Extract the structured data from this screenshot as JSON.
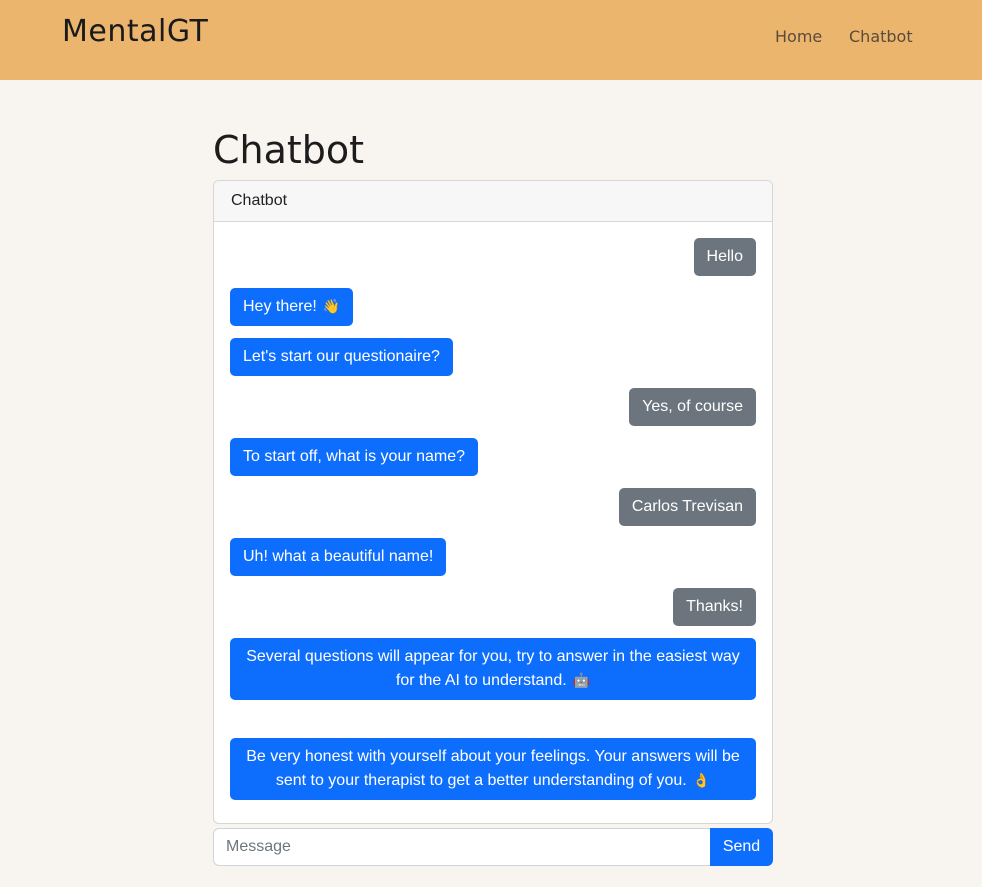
{
  "navbar": {
    "brand": "MentalGT",
    "links": [
      {
        "label": "Home"
      },
      {
        "label": "Chatbot"
      }
    ]
  },
  "page_title": "Chatbot",
  "card": {
    "header": "Chatbot",
    "messages": [
      {
        "sender": "user",
        "text": "Hello"
      },
      {
        "sender": "bot",
        "text": "Hey there!",
        "emoji": "👋"
      },
      {
        "sender": "bot",
        "text": "Let's start our questionaire?"
      },
      {
        "sender": "user",
        "text": "Yes, of course"
      },
      {
        "sender": "bot",
        "text": "To start off, what is your name?"
      },
      {
        "sender": "user",
        "text": "Carlos Trevisan"
      },
      {
        "sender": "bot",
        "text": "Uh! what a beautiful name!"
      },
      {
        "sender": "user",
        "text": "Thanks!"
      },
      {
        "sender": "bot",
        "text": "Several questions will appear for you, try to answer in the easiest way for the AI to understand.",
        "emoji": "🤖"
      },
      {
        "sender": "bot",
        "text": "Be very honest with yourself about your feelings. Your answers will be sent to your therapist to get a better understanding of you.",
        "emoji": "👌"
      }
    ]
  },
  "composer": {
    "placeholder": "Message",
    "value": "",
    "send_label": "Send"
  },
  "colors": {
    "navbar": "#ebb56e",
    "background": "#f8f4ef",
    "bot_bubble": "#0d6efd",
    "user_bubble": "#6c757d"
  }
}
